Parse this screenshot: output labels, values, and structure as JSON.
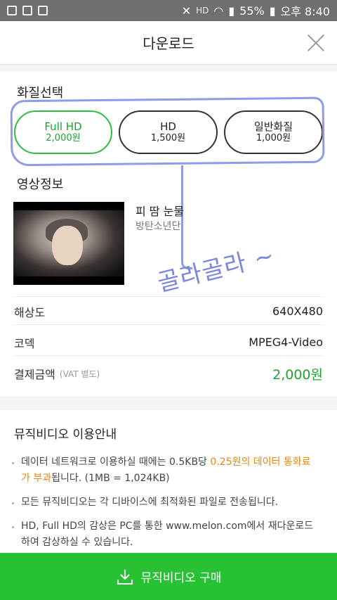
{
  "status_bar": {
    "network_label": "HD",
    "battery": "55%",
    "time": "오후 8:40"
  },
  "header": {
    "title": "다운로드"
  },
  "quality": {
    "section_title": "화질선택",
    "options": [
      {
        "name": "Full HD",
        "price": "2,000원",
        "selected": true
      },
      {
        "name": "HD",
        "price": "1,500원",
        "selected": false
      },
      {
        "name": "일반화질",
        "price": "1,000원",
        "selected": false
      }
    ]
  },
  "video_info": {
    "section_title": "영상정보",
    "title": "피 땀 눈물",
    "artist": "방탄소년단",
    "rows": [
      {
        "label": "해상도",
        "value": "640X480"
      },
      {
        "label": "코덱",
        "value": "MPEG4-Video"
      },
      {
        "label": "결제금액",
        "sub": "(VAT 별도)",
        "value": "2,000원"
      }
    ]
  },
  "notice": {
    "title": "뮤직비디오 이용안내",
    "items": [
      {
        "text_a": "데이터 네트워크로 이용하실 때에는 0.5KB당 ",
        "highlight": "0.25원의 데이터 통화료가 부과",
        "text_b": "됩니다. (1MB = 1,024KB)"
      },
      {
        "text": "모든 뮤직비디오는 각 디바이스에 최적화된 파일로 전송됩니다."
      },
      {
        "text": "HD, Full HD의 감상은 PC를 통한 www.melon.com에서 재다운로드 하여 감상하실 수 있습니다."
      }
    ]
  },
  "annotation": {
    "handwriting": "골라골라 ~"
  },
  "buy_button": {
    "label": "뮤직비디오 구매"
  },
  "colors": {
    "accent_green": "#27c133",
    "highlight_orange": "#e8850d",
    "annotation_blue": "#8f9ae8"
  }
}
